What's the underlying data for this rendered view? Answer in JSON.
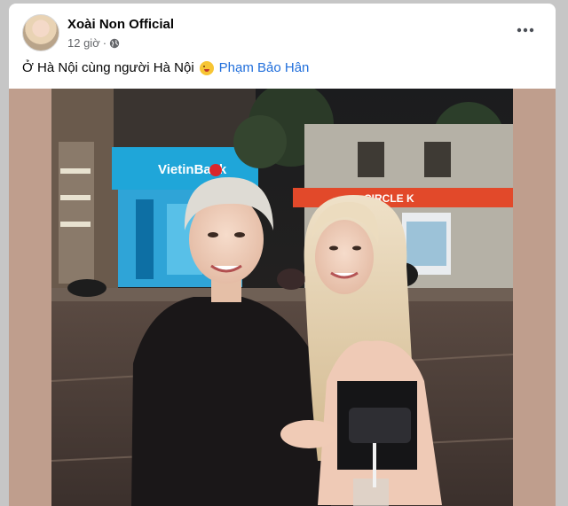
{
  "post": {
    "author": "Xoài Non Official",
    "time": "12 giờ",
    "dot": "·",
    "privacy_icon": "globe-icon",
    "more_icon": "more-options-icon",
    "caption_text": "Ở Hà Nội cùng người Hà Nội",
    "caption_emoji": "rolling-on-floor-laughing-emoji",
    "mention": "Phạm Bảo Hân"
  },
  "photo": {
    "sign_text": "VietinBank",
    "store_sign": "CIRCLE K"
  },
  "colors": {
    "frame": "#bf9e8d",
    "mention": "#216fdb",
    "meta": "#65676b",
    "vietinbank_sign": "#1fa6d9",
    "circlek_sign": "#e2492a"
  }
}
